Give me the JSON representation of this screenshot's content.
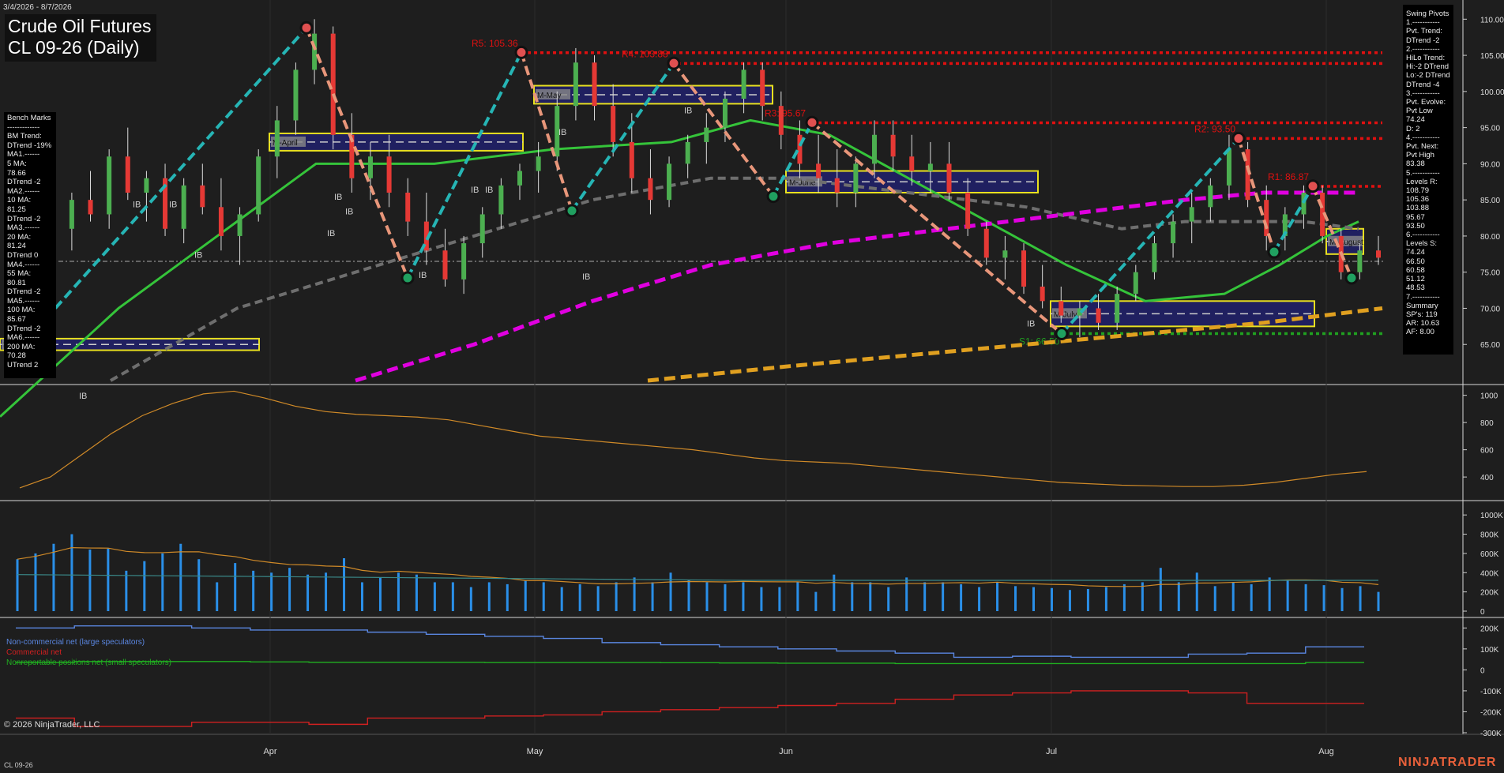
{
  "header": {
    "date_range": "3/4/2026 - 8/7/2026",
    "title_line1": "Crude Oil Futures",
    "title_line2": "CL 09-26 (Daily)"
  },
  "bench_marks": [
    "Bench Marks",
    "-------------",
    "BM Trend:",
    "DTrend -19%",
    "MA1.------",
    "5 MA:",
    "78.66",
    "DTrend -2",
    "MA2.------",
    "10 MA:",
    "81.25",
    "DTrend -2",
    "MA3.------",
    "20 MA:",
    "81.24",
    "DTrend 0",
    "MA4.------",
    "55 MA:",
    "80.81",
    "DTrend -2",
    "MA5.------",
    "100 MA:",
    "85.67",
    "DTrend -2",
    "MA6.------",
    "200 MA:",
    "70.28",
    "UTrend 2"
  ],
  "swing_pivots": [
    "Swing Pivots",
    "1.-----------",
    "Pvt. Trend:",
    "DTrend -2",
    "2.-----------",
    "HiLo Trend:",
    "Hi:-2 DTrend",
    "Lo:-2 DTrend",
    "DTrend -4",
    "3.-----------",
    "Pvt. Evolve:",
    "Pvt Low",
    "74.24",
    "D: 2",
    "4.-----------",
    "Pvt. Next:",
    "Pvt High",
    "83.38",
    "5.-----------",
    "Levels R:",
    "108.79",
    "105.36",
    "103.88",
    "95.67",
    "93.50",
    "6.-----------",
    "Levels S:",
    "74.24",
    "66.50",
    "60.58",
    "51.12",
    "48.53",
    "7.-----------",
    "Summary",
    "SP's: 119",
    "AR: 10.63",
    "AF: 8.00"
  ],
  "copyright": "© 2026 NinjaTrader, LLC",
  "instrument_footer": "CL 09-26",
  "logo": "NINJATRADER",
  "cot_legend": {
    "noncommercial": "Non-commercial net (large speculators)",
    "commercial": "Commercial net",
    "nonreportable": "Nonreportable positions net (small speculators)"
  },
  "colors": {
    "background": "#1e1e1e",
    "up_candle": "#4caf50",
    "down_candle": "#e53935",
    "ma_green": "#35c43a",
    "ma_gray": "#6e6e6e",
    "ma_magenta": "#e000e0",
    "ma_orange": "#e0a020",
    "swing_up": "#26b5b5",
    "swing_down": "#e8967a",
    "resistance": "#e01010",
    "support": "#20a020",
    "month_box": "#202060",
    "month_box_border": "#e8e020",
    "volume_bar": "#2a8fe8",
    "noncommercial": "#5a86e0",
    "commercial": "#d02020",
    "nonreportable": "#20b020"
  },
  "chart_data": [
    {
      "type": "candlestick",
      "title": "Crude Oil Futures CL 09-26 (Daily)",
      "x_labels": [
        "Apr",
        "May",
        "Jun",
        "Jul",
        "Aug"
      ],
      "y_ticks": [
        65.0,
        70.0,
        75.0,
        80.0,
        85.0,
        90.0,
        95.0,
        100.0,
        105.0,
        110.0
      ],
      "ylim": [
        60,
        112
      ],
      "ohlc_approx": [
        [
          76,
          80,
          69,
          71
        ],
        [
          71,
          77,
          70,
          76
        ],
        [
          76,
          82,
          75,
          81
        ],
        [
          81,
          86,
          78,
          85
        ],
        [
          85,
          89,
          82,
          83
        ],
        [
          83,
          92,
          81,
          91
        ],
        [
          91,
          95,
          85,
          86
        ],
        [
          86,
          89,
          82,
          88
        ],
        [
          88,
          90,
          80,
          81
        ],
        [
          81,
          88,
          79,
          87
        ],
        [
          87,
          90,
          83,
          84
        ],
        [
          84,
          88,
          78,
          80
        ],
        [
          80,
          84,
          76,
          83
        ],
        [
          83,
          92,
          82,
          91
        ],
        [
          91,
          98,
          88,
          96
        ],
        [
          96,
          104,
          94,
          103
        ],
        [
          103,
          110,
          101,
          108
        ],
        [
          108,
          109,
          92,
          94
        ],
        [
          94,
          97,
          86,
          88
        ],
        [
          88,
          93,
          85,
          91
        ],
        [
          91,
          94,
          84,
          86
        ],
        [
          86,
          88,
          80,
          82
        ],
        [
          82,
          86,
          76,
          78
        ],
        [
          78,
          81,
          73,
          74
        ],
        [
          74,
          80,
          72,
          79
        ],
        [
          79,
          84,
          77,
          83
        ],
        [
          83,
          88,
          81,
          87
        ],
        [
          87,
          90,
          85,
          89
        ],
        [
          89,
          93,
          86,
          91
        ],
        [
          91,
          100,
          89,
          98
        ],
        [
          98,
          106,
          96,
          104
        ],
        [
          104,
          105,
          96,
          98
        ],
        [
          98,
          101,
          91,
          93
        ],
        [
          93,
          97,
          86,
          88
        ],
        [
          88,
          92,
          83,
          85
        ],
        [
          85,
          91,
          84,
          90
        ],
        [
          90,
          94,
          88,
          93
        ],
        [
          93,
          97,
          90,
          95
        ],
        [
          95,
          100,
          93,
          99
        ],
        [
          99,
          104,
          97,
          103
        ],
        [
          103,
          104,
          96,
          98
        ],
        [
          98,
          100,
          92,
          94
        ],
        [
          94,
          96,
          88,
          90
        ],
        [
          90,
          94,
          86,
          88
        ],
        [
          88,
          92,
          84,
          86
        ],
        [
          86,
          91,
          84,
          90
        ],
        [
          90,
          96,
          88,
          94
        ],
        [
          94,
          96,
          89,
          91
        ],
        [
          91,
          94,
          87,
          89
        ],
        [
          89,
          93,
          86,
          90
        ],
        [
          90,
          93,
          85,
          86
        ],
        [
          86,
          88,
          80,
          81
        ],
        [
          81,
          82,
          76,
          77
        ],
        [
          77,
          80,
          74,
          78
        ],
        [
          78,
          79,
          72,
          73
        ],
        [
          73,
          76,
          70,
          71
        ],
        [
          71,
          73,
          68,
          69
        ],
        [
          69,
          71,
          66,
          70
        ],
        [
          70,
          72,
          67,
          68
        ],
        [
          68,
          73,
          67,
          72
        ],
        [
          72,
          76,
          71,
          75
        ],
        [
          75,
          80,
          74,
          79
        ],
        [
          79,
          83,
          77,
          82
        ],
        [
          82,
          86,
          79,
          84
        ],
        [
          84,
          88,
          82,
          87
        ],
        [
          87,
          94,
          85,
          92
        ],
        [
          92,
          93,
          84,
          85
        ],
        [
          85,
          87,
          78,
          80
        ],
        [
          80,
          84,
          78,
          83
        ],
        [
          83,
          87,
          81,
          86
        ],
        [
          86,
          87,
          79,
          80
        ],
        [
          80,
          81,
          74,
          75
        ],
        [
          75,
          79,
          74,
          78
        ],
        [
          78,
          80,
          76,
          77
        ]
      ],
      "pivots": [
        {
          "label": "R5: 105.36",
          "value": 105.36
        },
        {
          "label": "R4: 103.88",
          "value": 103.88
        },
        {
          "label": "R3: 95.67",
          "value": 95.67
        },
        {
          "label": "R2: 93.50",
          "value": 93.5
        },
        {
          "label": "R1: 86.87",
          "value": 86.87
        },
        {
          "label": "S1: 66.50",
          "value": 66.5
        }
      ],
      "month_boxes": [
        {
          "label": "M-March",
          "hi": 65.8,
          "lo": 64.2
        },
        {
          "label": "M-April",
          "hi": 94.2,
          "lo": 91.8
        },
        {
          "label": "M-May",
          "hi": 100.8,
          "lo": 98.3
        },
        {
          "label": "M-June",
          "hi": 89.0,
          "lo": 86.0
        },
        {
          "label": "M-July",
          "hi": 71.0,
          "lo": 67.5
        },
        {
          "label": "M-August",
          "hi": 81.0,
          "lo": 77.5
        }
      ],
      "ib_labels": [
        "IB",
        "IB",
        "IB",
        "IB",
        "IB",
        "IB",
        "IB",
        "IB",
        "IB",
        "IB",
        "IB",
        "IB",
        "IB",
        "IB"
      ]
    },
    {
      "type": "line",
      "name": "Indicator",
      "y_ticks": [
        400,
        600,
        800,
        1000
      ],
      "ylim": [
        250,
        1050
      ],
      "values": [
        320,
        400,
        560,
        720,
        850,
        940,
        1010,
        1030,
        980,
        920,
        880,
        860,
        850,
        840,
        820,
        780,
        740,
        700,
        680,
        660,
        640,
        620,
        600,
        570,
        540,
        520,
        510,
        500,
        480,
        460,
        440,
        420,
        400,
        380,
        360,
        350,
        340,
        335,
        330,
        330,
        340,
        360,
        390,
        420,
        440
      ]
    },
    {
      "type": "bar",
      "name": "Volume",
      "y_ticks": [
        "0",
        "200K",
        "400K",
        "600K",
        "800K",
        "1000K"
      ],
      "ylim": [
        0,
        1100
      ],
      "values_k": [
        540,
        600,
        700,
        800,
        640,
        650,
        420,
        520,
        600,
        700,
        540,
        300,
        500,
        420,
        400,
        450,
        380,
        400,
        550,
        300,
        350,
        400,
        380,
        300,
        300,
        250,
        300,
        280,
        320,
        300,
        250,
        280,
        260,
        300,
        350,
        300,
        400,
        320,
        300,
        280,
        300,
        250,
        250,
        300,
        200,
        380,
        300,
        300,
        250,
        350,
        300,
        300,
        280,
        250,
        300,
        260,
        250,
        240,
        220,
        230,
        250,
        280,
        300,
        450,
        300,
        400,
        260,
        300,
        280,
        350,
        320,
        280,
        270,
        240,
        260,
        200
      ]
    },
    {
      "type": "line",
      "name": "COT",
      "y_ticks": [
        "-300K",
        "-200K",
        "-100K",
        "0",
        "100K",
        "200K"
      ],
      "ylim": [
        -300,
        220
      ],
      "series": [
        {
          "name": "Non-commercial net (large speculators)",
          "values": [
            200,
            210,
            210,
            200,
            190,
            190,
            180,
            170,
            160,
            150,
            130,
            120,
            110,
            100,
            90,
            80,
            60,
            65,
            60,
            60,
            75,
            80,
            110,
            110
          ]
        },
        {
          "name": "Commercial net",
          "values": [
            -230,
            -270,
            -270,
            -250,
            -250,
            -260,
            -230,
            -230,
            -220,
            -215,
            -200,
            -190,
            -180,
            -170,
            -160,
            -140,
            -120,
            -110,
            -100,
            -100,
            -110,
            -160,
            -160,
            -160
          ]
        },
        {
          "name": "Nonreportable positions net (small speculators)",
          "values": [
            35,
            40,
            40,
            40,
            38,
            36,
            36,
            36,
            35,
            35,
            35,
            34,
            33,
            32,
            32,
            30,
            30,
            30,
            30,
            30,
            30,
            30,
            35,
            35
          ]
        }
      ]
    }
  ]
}
